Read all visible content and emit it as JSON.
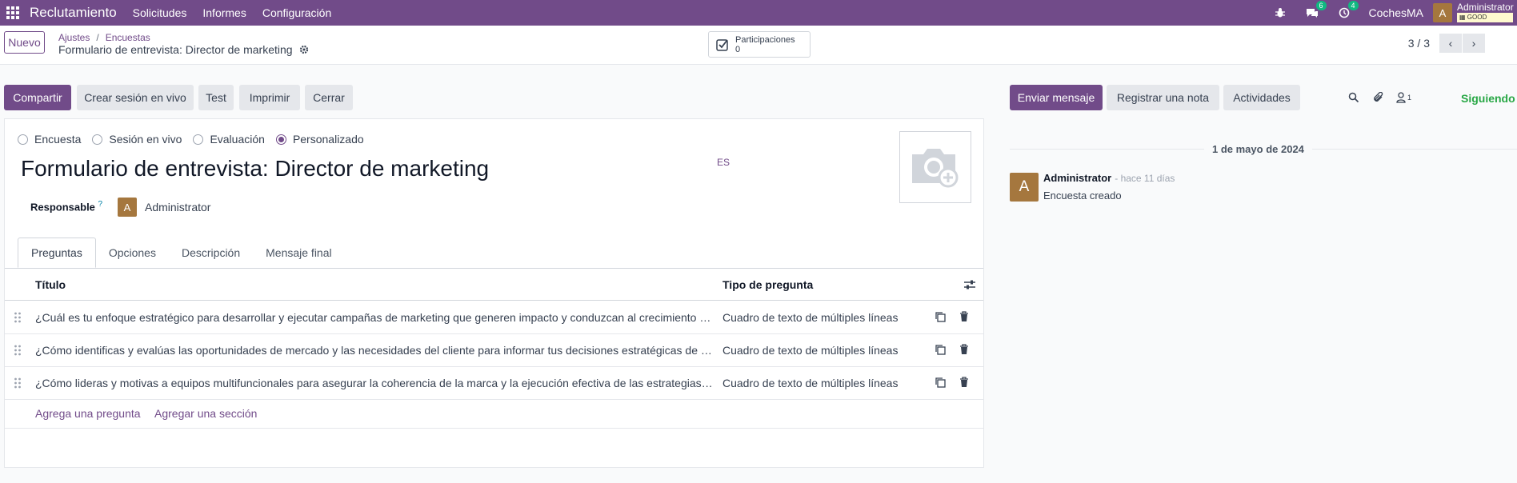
{
  "navbar": {
    "app_name": "Reclutamiento",
    "menus": [
      "Solicitudes",
      "Informes",
      "Configuración"
    ],
    "messages_count": "6",
    "activities_count": "4",
    "company": "CochesMA",
    "user_initial": "A",
    "user_name": "Administrator",
    "db_tag": "GOOD"
  },
  "control_panel": {
    "new_button": "Nuevo",
    "breadcrumb": [
      "Ajustes",
      "Encuestas"
    ],
    "record_title": "Formulario de entrevista: Director de marketing",
    "smart_button_label": "Participaciones",
    "smart_button_value": "0",
    "pager": "3 / 3"
  },
  "form_buttons": [
    "Compartir",
    "Crear sesión en vivo",
    "Test",
    "Imprimir",
    "Cerrar"
  ],
  "form": {
    "survey_types": [
      "Encuesta",
      "Sesión en vivo",
      "Evaluación",
      "Personalizado"
    ],
    "selected_type": "Personalizado",
    "title": "Formulario de entrevista: Director de marketing",
    "lang": "ES",
    "responsible_label": "Responsable",
    "responsible_help": "?",
    "responsible_initial": "A",
    "responsible_name": "Administrator",
    "tabs": [
      "Preguntas",
      "Opciones",
      "Descripción",
      "Mensaje final"
    ],
    "active_tab": "Preguntas",
    "table": {
      "headers": [
        "Título",
        "Tipo de pregunta"
      ],
      "rows": [
        {
          "title": "¿Cuál es tu enfoque estratégico para desarrollar y ejecutar campañas de marketing que generen impacto y conduzcan al crecimiento de...",
          "type": "Cuadro de texto de múltiples líneas"
        },
        {
          "title": "¿Cómo identificas y evalúas las oportunidades de mercado y las necesidades del cliente para informar tus decisiones estratégicas de ma...",
          "type": "Cuadro de texto de múltiples líneas"
        },
        {
          "title": "¿Cómo lideras y motivas a equipos multifuncionales para asegurar la coherencia de la marca y la ejecución efectiva de las estrategias de...",
          "type": "Cuadro de texto de múltiples líneas"
        }
      ],
      "add_question": "Agrega una pregunta",
      "add_section": "Agregar una sección"
    }
  },
  "chatter": {
    "buttons": [
      "Enviar mensaje",
      "Registrar una nota",
      "Actividades"
    ],
    "followers_count": "1",
    "following": "Siguiendo",
    "date_separator": "1 de mayo de 2024",
    "message": {
      "author_initial": "A",
      "author": "Administrator",
      "time": "- hace 11 días",
      "body": "Encuesta creado"
    }
  },
  "colors": {
    "brand": "#714b89",
    "success": "#10b981",
    "following": "#28a745",
    "avatar": "#a5773e"
  }
}
